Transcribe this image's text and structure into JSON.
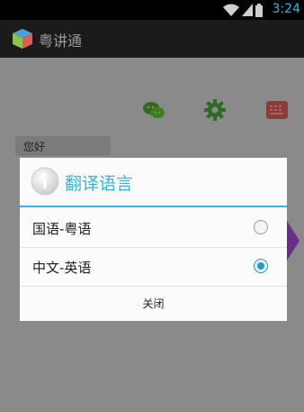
{
  "status_bar": {
    "time": "3:24",
    "icons": [
      "wifi-icon",
      "signal-icon",
      "battery-icon"
    ]
  },
  "action_bar": {
    "title": "粤讲通",
    "icon": "cube-icon"
  },
  "toolbar": {
    "icons": [
      "wechat-icon",
      "gear-icon",
      "keyboard-icon"
    ]
  },
  "chat": {
    "bubble_text": "您好"
  },
  "dialog": {
    "title": "翻译语言",
    "icon": "info-icon",
    "options": [
      {
        "label": "国语-粤语",
        "checked": false
      },
      {
        "label": "中文-英语",
        "checked": true
      }
    ],
    "close_label": "关闭"
  },
  "colors": {
    "accent": "#33b5e5",
    "status_bar": "#000000",
    "action_bar": "#1b1b1b",
    "dim_overlay": "#8a8a8a"
  }
}
